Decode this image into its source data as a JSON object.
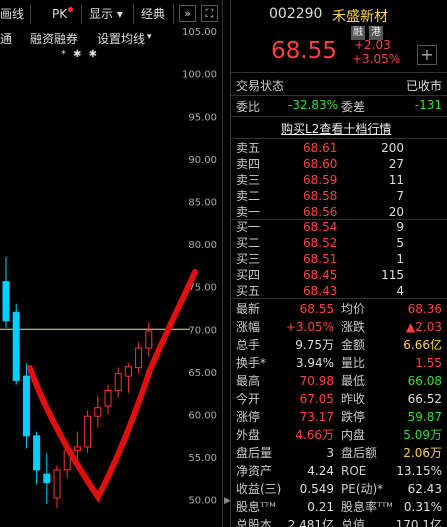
{
  "toolbar": {
    "item_left": "画线",
    "pk": "PK",
    "display": "显示",
    "classic": "经典",
    "forward": "»",
    "expand": "⛶"
  },
  "subbar": {
    "item_left": "通",
    "margin": "融资融券",
    "ma_settings": "设置均线",
    "dropdown": "▾",
    "stars": "* ✱ ✱"
  },
  "y_axis_labels": [
    "105.00",
    "100.00",
    "95.00",
    "90.00",
    "85.00",
    "80.00",
    "75.00",
    "70.00",
    "65.00",
    "60.00",
    "55.00",
    "50.00"
  ],
  "chart_data": {
    "type": "candlestick",
    "y_ticks": [
      105,
      100,
      95,
      90,
      85,
      80,
      75,
      70,
      65,
      60,
      55,
      50
    ],
    "reference_line": 70.0,
    "colors": {
      "up": "#ff3030",
      "down": "#00d0ff",
      "ref": "#e6e680",
      "annotation": "#e01010"
    },
    "candles": [
      {
        "o": 75.6,
        "h": 78.5,
        "l": 70.2,
        "c": 71.0
      },
      {
        "o": 72.0,
        "h": 73.0,
        "l": 63.5,
        "c": 64.0
      },
      {
        "o": 64.5,
        "h": 66.0,
        "l": 56.0,
        "c": 57.5
      },
      {
        "o": 57.5,
        "h": 58.0,
        "l": 51.8,
        "c": 53.5
      },
      {
        "o": 53.0,
        "h": 55.5,
        "l": 49.5,
        "c": 52.0
      },
      {
        "o": 50.2,
        "h": 54.0,
        "l": 49.0,
        "c": 53.5
      },
      {
        "o": 53.5,
        "h": 56.5,
        "l": 52.5,
        "c": 55.8
      },
      {
        "o": 55.8,
        "h": 58.0,
        "l": 54.2,
        "c": 56.2
      },
      {
        "o": 56.2,
        "h": 60.5,
        "l": 55.5,
        "c": 59.8
      },
      {
        "o": 59.8,
        "h": 62.2,
        "l": 58.5,
        "c": 60.8
      },
      {
        "o": 61.0,
        "h": 63.5,
        "l": 60.0,
        "c": 62.8
      },
      {
        "o": 62.8,
        "h": 65.5,
        "l": 62.0,
        "c": 64.8
      },
      {
        "o": 64.5,
        "h": 66.0,
        "l": 62.5,
        "c": 65.6
      },
      {
        "o": 65.5,
        "h": 68.5,
        "l": 64.8,
        "c": 67.8
      },
      {
        "o": 67.8,
        "h": 70.8,
        "l": 66.8,
        "c": 69.8
      }
    ]
  },
  "quote": {
    "code": "002290",
    "name": "禾盛新材",
    "badge1": "融",
    "badge2": "港",
    "price": "68.55",
    "change": "+2.03",
    "change_pct": "+3.05%",
    "add": "+"
  },
  "trade": {
    "status_label": "交易状态",
    "status_value": "已收市",
    "wb_label": "委比",
    "wb_value": "-32.83%",
    "wc_label": "委差",
    "wc_value": "-131",
    "l2_link": "购买L2查看十档行情"
  },
  "orderbook": {
    "asks": [
      {
        "label": "卖五",
        "price": "68.61",
        "vol": "200"
      },
      {
        "label": "卖四",
        "price": "68.60",
        "vol": "27"
      },
      {
        "label": "卖三",
        "price": "68.59",
        "vol": "11"
      },
      {
        "label": "卖二",
        "price": "68.58",
        "vol": "7"
      },
      {
        "label": "卖一",
        "price": "68.56",
        "vol": "20"
      }
    ],
    "bids": [
      {
        "label": "买一",
        "price": "68.54",
        "vol": "9"
      },
      {
        "label": "买二",
        "price": "68.52",
        "vol": "5"
      },
      {
        "label": "买三",
        "price": "68.51",
        "vol": "1"
      },
      {
        "label": "买四",
        "price": "68.45",
        "vol": "115"
      },
      {
        "label": "买五",
        "price": "68.43",
        "vol": "4"
      }
    ]
  },
  "stats": [
    {
      "l1": "最新",
      "v1": "68.55",
      "c1": "red",
      "l2": "均价",
      "v2": "68.36",
      "c2": "red"
    },
    {
      "l1": "涨幅",
      "v1": "+3.05%",
      "c1": "red",
      "l2": "涨跌",
      "v2": "▲2.03",
      "c2": "red"
    },
    {
      "l1": "总手",
      "v1": "9.75万",
      "c1": "white",
      "l2": "金额",
      "v2": "6.66亿",
      "c2": "yellow"
    },
    {
      "l1": "换手*",
      "v1": "3.94%",
      "c1": "white",
      "l2": "量比",
      "v2": "1.55",
      "c2": "red"
    },
    {
      "l1": "最高",
      "v1": "70.98",
      "c1": "red",
      "l2": "最低",
      "v2": "66.08",
      "c2": "green"
    },
    {
      "l1": "今开",
      "v1": "67.05",
      "c1": "red",
      "l2": "昨收",
      "v2": "66.52",
      "c2": "white"
    },
    {
      "l1": "涨停",
      "v1": "73.17",
      "c1": "red",
      "l2": "跌停",
      "v2": "59.87",
      "c2": "green"
    },
    {
      "l1": "外盘",
      "v1": "4.66万",
      "c1": "red",
      "l2": "内盘",
      "v2": "5.09万",
      "c2": "green"
    },
    {
      "l1": "盘后量",
      "v1": "3",
      "c1": "white",
      "l2": "盘后额",
      "v2": "2.06万",
      "c2": "yellow"
    },
    {
      "l1": "净资产",
      "v1": "4.24",
      "c1": "white",
      "l2": "ROE",
      "v2": "13.15%",
      "c2": "white"
    },
    {
      "l1": "收益(三)",
      "v1": "0.549",
      "c1": "white",
      "l2": "PE(动)*",
      "v2": "62.43",
      "c2": "white"
    },
    {
      "l1": "股息ᵀᵀᴹ",
      "v1": "0.21",
      "c1": "white",
      "l2": "股息率ᵀᵀᴹ",
      "v2": "0.31%",
      "c2": "white"
    },
    {
      "l1": "总股本",
      "v1": "2.481亿",
      "c1": "white",
      "l2": "总值",
      "v2": "170.1亿",
      "c2": "white"
    }
  ]
}
